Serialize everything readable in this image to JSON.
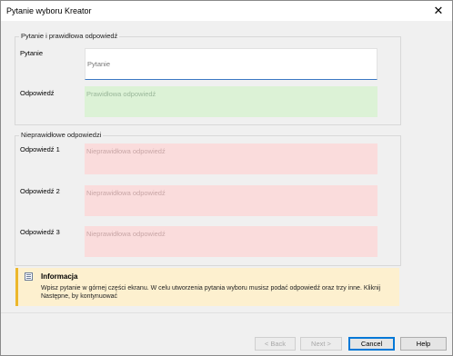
{
  "window": {
    "title": "Pytanie wyboru Kreator",
    "close_glyph": "✕"
  },
  "question_group": {
    "title": "Pytanie i prawidłowa odpowiedź",
    "question_label": "Pytanie",
    "question_placeholder": "Pytanie",
    "answer_label": "Odpowiedź",
    "answer_placeholder": "Prawidłowa odpowiedź"
  },
  "wrong_group": {
    "title": "Nieprawidłowe odpowiedzi",
    "items": [
      {
        "label": "Odpowiedź 1",
        "placeholder": "Nieprawidłowa odpowiedź"
      },
      {
        "label": "Odpowiedź 2",
        "placeholder": "Nieprawidłowa odpowiedź"
      },
      {
        "label": "Odpowiedź 3",
        "placeholder": "Nieprawidłowa odpowiedź"
      }
    ]
  },
  "info": {
    "icon": "document-info-icon",
    "title": "Informacja",
    "text": "Wpisz pytanie w górnej części ekranu. W celu utworzenia pytania wyboru musisz podać odpowiedź oraz trzy inne. Kliknij Następne, by kontynuować"
  },
  "buttons": {
    "back": "< Back",
    "next": "Next >",
    "cancel": "Cancel",
    "help": "Help"
  },
  "colors": {
    "correct_bg": "#dcf2d6",
    "wrong_bg": "#fadcdc",
    "info_bg": "#fdf0cf",
    "info_accent": "#ecb72b",
    "focus_blue": "#0078d7"
  }
}
